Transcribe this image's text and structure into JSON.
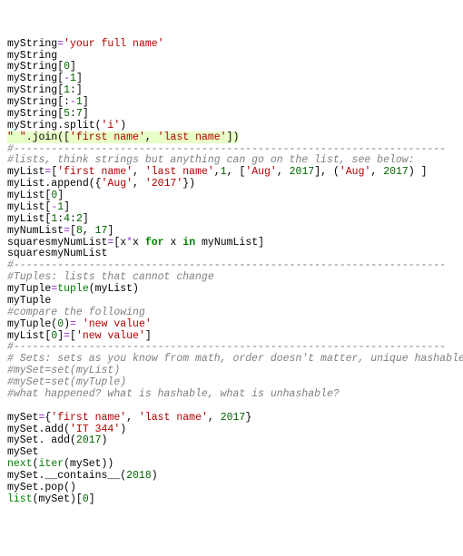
{
  "lines": {
    "l1_pre": "myString",
    "l1_eq": "=",
    "l1_str": "'your full name'",
    "l2": "myString",
    "l3_pre": "myString[",
    "l3_n": "0",
    "l3_post": "]",
    "l4_pre": "myString[",
    "l4_op": "-",
    "l4_n": "1",
    "l4_post": "]",
    "l5_pre": "myString[",
    "l5_n": "1",
    "l5_post": ":]",
    "l6_pre": "myString[:",
    "l6_op": "-",
    "l6_n": "1",
    "l6_post": "]",
    "l7_pre": "myString[",
    "l7_n1": "5",
    "l7_mid": ":",
    "l7_n2": "7",
    "l7_post": "]",
    "l8_pre": "myString.split(",
    "l8_str": "'i'",
    "l8_post": ")",
    "l9_str1": "\" \"",
    "l9_mid": ".join([",
    "l9_str2": "'first name'",
    "l9_c": ", ",
    "l9_str3": "'last name'",
    "l9_post": "])",
    "c1": "#---------------------------------------------------------------------",
    "c2": "#lists, think strings but anything can go on the list, see below:",
    "l10_pre": "myList",
    "l10_eq": "=",
    "l10_a": "[",
    "l10_s1": "'first name'",
    "l10_c1": ", ",
    "l10_s2": "'last name'",
    "l10_c2": ",",
    "l10_n1": "1",
    "l10_c3": ", [",
    "l10_s3": "'Aug'",
    "l10_c4": ", ",
    "l10_n2": "2017",
    "l10_c5": "], (",
    "l10_s4": "'Aug'",
    "l10_c6": ", ",
    "l10_n3": "2017",
    "l10_c7": ") ]",
    "l11_pre": "myList.append({",
    "l11_s1": "'Aug'",
    "l11_c": ", ",
    "l11_s2": "'2017'",
    "l11_post": "})",
    "l12_pre": "myList[",
    "l12_n": "0",
    "l12_post": "]",
    "l13_pre": "myList[",
    "l13_op": "-",
    "l13_n": "1",
    "l13_post": "]",
    "l14_pre": "myList[",
    "l14_n1": "1",
    "l14_c1": ":",
    "l14_n2": "4",
    "l14_c2": ":",
    "l14_n3": "2",
    "l14_post": "]",
    "l15_pre": "myNumList",
    "l15_eq": "=",
    "l15_a": "[",
    "l15_n1": "8",
    "l15_c": ", ",
    "l15_n2": "17",
    "l15_post": "]",
    "l16_pre": "squaresmyNumList",
    "l16_eq": "=",
    "l16_a": "[x",
    "l16_op": "*",
    "l16_b": "x ",
    "l16_k1": "for",
    "l16_c": " x ",
    "l16_k2": "in",
    "l16_d": " myNumList]",
    "l17": "squaresmyNumList",
    "c3": "#---------------------------------------------------------------------",
    "c4": "#Tuples: lists that cannot change",
    "l18_pre": "myTuple",
    "l18_eq": "=",
    "l18_fn": "tuple",
    "l18_post": "(myList)",
    "l19": "myTuple",
    "c5": "#compare the following",
    "l20_pre": "myTuple(",
    "l20_n": "0",
    "l20_mid": ")",
    "l20_eq": "= ",
    "l20_str": "'new value'",
    "l21_pre": "myList[",
    "l21_n": "0",
    "l21_mid": "]",
    "l21_eq": "=",
    "l21_a": "[",
    "l21_str": "'new value'",
    "l21_post": "]",
    "c6": "#---------------------------------------------------------------------",
    "c7": "# Sets: sets as you know from math, order doesn't matter, unique hashable",
    "c8": "#mySet=set(myList)",
    "c9": "#mySet=set(myTuple)",
    "c10": "#what happened? what is hashable, what is unhashable?",
    "blank": " ",
    "l22_pre": "mySet",
    "l22_eq": "=",
    "l22_a": "{",
    "l22_s1": "'first name'",
    "l22_c1": ", ",
    "l22_s2": "'last name'",
    "l22_c2": ", ",
    "l22_n": "2017",
    "l22_post": "}",
    "l23_pre": "mySet.add(",
    "l23_str": "'IT 344'",
    "l23_post": ")",
    "l24_pre": "mySet. add(",
    "l24_n": "2017",
    "l24_post": ")",
    "l25": "mySet",
    "l26_fn": "next",
    "l26_a": "(",
    "l26_fn2": "iter",
    "l26_post": "(mySet))",
    "l27_pre": "mySet.__contains__(",
    "l27_n": "2018",
    "l27_post": ")",
    "l28": "mySet.pop()",
    "l29_fn": "list",
    "l29_a": "(mySet)[",
    "l29_n": "0",
    "l29_post": "]"
  }
}
